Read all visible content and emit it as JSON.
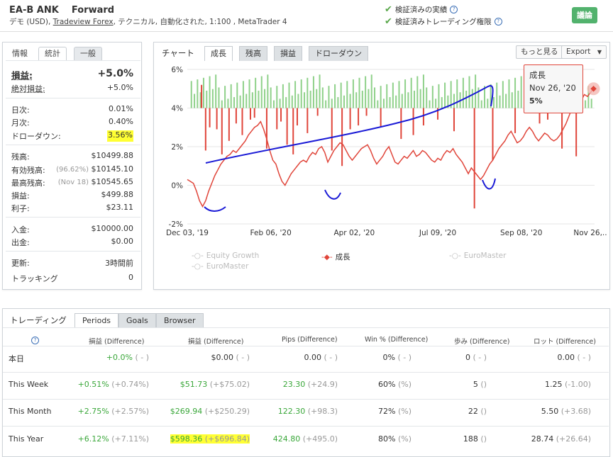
{
  "header": {
    "title": "EA-B ANK    Forward",
    "subtitle_prefix": "デモ (USD), ",
    "broker": "Tradeview Forex",
    "subtitle_suffix": ", テクニカル, 自動化された, 1:100 , MetaTrader 4",
    "verified_track": "検証済みの実績",
    "verified_trading": "検証済みトレーディング権限",
    "discuss_label": "議論"
  },
  "stats": {
    "tabs": [
      "情報",
      "統計",
      "一般"
    ],
    "gain_label": "損益:",
    "gain": "+5.0%",
    "abs_gain_label": "絶対損益:",
    "abs_gain": "+5.0%",
    "daily_label": "日次:",
    "daily": "0.01%",
    "monthly_label": "月次:",
    "monthly": "0.40%",
    "drawdown_label": "ドローダウン:",
    "drawdown": "3.56%",
    "balance_label": "残高:",
    "balance": "$10499.88",
    "equity_label": "有効残高:",
    "equity_pct": "(96.62%)",
    "equity": "$10145.10",
    "highest_label": "最高残高:",
    "highest_date": "(Nov 18)",
    "highest": "$10545.65",
    "profit_label": "損益:",
    "profit": "$499.88",
    "interest_label": "利子:",
    "interest": "$23.11",
    "deposits_label": "入金:",
    "deposits": "$10000.00",
    "withdrawals_label": "出金:",
    "withdrawals": "$0.00",
    "updated_label": "更新:",
    "updated": "3時間前",
    "tracking_label": "トラッキング",
    "tracking": "0"
  },
  "chart_panel": {
    "title": "チャート",
    "tabs": [
      "成長",
      "残高",
      "損益",
      "ドローダウン"
    ],
    "more_button": "もっと見る",
    "export_button": "Export",
    "tooltip": {
      "series": "成長",
      "date": "Nov 26, '20",
      "value": "5%"
    },
    "legend": [
      "Equity Growth",
      "成長",
      "EuroMaster",
      "EuroMaster"
    ]
  },
  "chart_data": {
    "type": "line",
    "y_ticks": [
      "6%",
      "4%",
      "2%",
      "0%",
      "-2%"
    ],
    "ylim": [
      -2,
      6
    ],
    "x_ticks": [
      "Dec 03, '19",
      "Feb 06, '20",
      "Apr 02, '20",
      "Jul 09, '20",
      "Sep 08, '20",
      "Nov 26,..."
    ],
    "series": [
      {
        "name": "成長",
        "color": "#e0453a",
        "x": [
          0,
          3,
          6,
          9,
          12,
          15,
          18,
          21,
          24,
          27,
          30,
          33,
          36,
          39,
          42,
          45,
          48,
          51,
          54,
          57,
          60,
          63,
          66,
          69,
          72,
          75,
          78,
          81,
          84,
          87,
          90,
          93,
          96,
          99,
          102,
          105,
          108,
          111,
          114,
          117,
          120,
          123,
          126,
          129,
          132,
          135,
          138,
          141,
          144,
          147,
          150,
          153,
          156,
          159,
          162,
          165,
          168,
          171,
          174,
          177,
          180,
          183,
          186,
          189,
          192,
          195,
          198,
          201,
          204,
          207,
          210,
          213,
          216,
          219,
          222,
          225,
          228,
          231,
          234,
          237,
          240,
          243,
          246,
          249,
          252,
          255,
          258,
          261,
          264,
          267,
          270,
          273,
          276,
          279,
          282,
          285,
          288,
          291,
          294,
          297,
          300,
          303,
          306,
          309,
          312,
          315,
          318,
          321,
          324,
          327,
          330,
          333,
          336,
          339,
          342,
          345,
          348,
          351,
          354,
          357,
          360,
          363,
          366,
          369,
          372,
          375,
          378,
          381,
          384,
          387,
          390,
          393,
          396,
          399
        ],
        "values": [
          0.3,
          0.2,
          0.1,
          -0.3,
          -0.8,
          -1.1,
          -0.8,
          -0.3,
          0.1,
          0.5,
          0.8,
          1.1,
          1.3,
          1.5,
          1.6,
          1.8,
          1.7,
          1.9,
          2.1,
          2.3,
          2.6,
          2.8,
          3.0,
          3.1,
          3.3,
          2.9,
          2.4,
          1.8,
          1.3,
          1.1,
          0.6,
          0.2,
          0.0,
          0.3,
          0.6,
          0.8,
          1.0,
          1.2,
          1.3,
          1.2,
          1.5,
          1.7,
          1.6,
          1.9,
          2.0,
          1.7,
          1.2,
          1.5,
          1.8,
          2.0,
          2.2,
          2.1,
          1.8,
          1.5,
          1.3,
          1.5,
          1.7,
          1.9,
          2.0,
          2.1,
          1.8,
          1.4,
          1.1,
          1.3,
          1.5,
          1.8,
          2.0,
          1.6,
          1.2,
          1.1,
          1.3,
          1.5,
          1.4,
          1.6,
          1.8,
          1.5,
          1.6,
          1.8,
          1.7,
          1.5,
          1.3,
          1.2,
          1.4,
          1.3,
          1.6,
          1.8,
          1.7,
          1.9,
          1.6,
          1.4,
          1.2,
          0.9,
          0.6,
          0.9,
          0.7,
          0.5,
          0.3,
          0.5,
          0.8,
          1.1,
          1.3,
          1.6,
          1.9,
          2.1,
          2.3,
          2.6,
          2.8,
          2.5,
          2.2,
          2.3,
          2.5,
          2.8,
          3.0,
          2.8,
          2.5,
          2.3,
          2.5,
          2.7,
          2.6,
          2.4,
          2.3,
          2.4,
          2.6,
          2.9,
          3.2,
          3.6,
          4.0,
          4.4,
          4.1,
          4.4,
          4.7,
          4.6,
          4.8,
          5.0
        ]
      }
    ],
    "bars_description_values": {
      "x": [
        14,
        18,
        22,
        29,
        34,
        41,
        48,
        54,
        62,
        66,
        78,
        88,
        92,
        98,
        104,
        108,
        118,
        128,
        142,
        152,
        160,
        168,
        176,
        190,
        210,
        222,
        232,
        246,
        262,
        282,
        300,
        322,
        346,
        354,
        368,
        382
      ],
      "values": [
        1.2,
        -2.2,
        -1.0,
        -1.1,
        -2.4,
        -1.7,
        -0.8,
        -1.4,
        -0.6,
        -0.5,
        -2.1,
        -1.1,
        -0.7,
        -1.9,
        -2.4,
        -0.9,
        -1.3,
        -0.4,
        -2.2,
        -3.0,
        -1.1,
        -0.9,
        -0.4,
        -1.0,
        -1.6,
        -1.4,
        -0.9,
        -0.6,
        -1.2,
        -5.2,
        -2.7,
        -1.3,
        -0.8,
        -0.6,
        -2.1,
        -2.5
      ]
    }
  },
  "trading": {
    "title": "トレーディング",
    "tabs": [
      "Periods",
      "Goals",
      "Browser"
    ],
    "headers": [
      "損益 (Difference)",
      "損益 (Difference)",
      "Pips (Difference)",
      "Win % (Difference)",
      "歩み (Difference)",
      "ロット (Difference)"
    ],
    "rows": [
      {
        "period": "本日",
        "gain": "+0.0%",
        "gain_diff": "( - )",
        "profit": "$0.00",
        "profit_diff": "( - )",
        "pips": "0.00",
        "pips_diff": "( - )",
        "win": "0%",
        "win_diff": "( - )",
        "trades": "0",
        "trades_diff": "( - )",
        "lots": "0.00",
        "lots_diff": "( - )"
      },
      {
        "period": "This Week",
        "gain": "+0.51%",
        "gain_diff": "(+0.74%)",
        "profit": "$51.73",
        "profit_diff": "(+$75.02)",
        "pips": "23.30",
        "pips_diff": "(+24.9)",
        "win": "60%",
        "win_diff": "(%)",
        "trades": "5",
        "trades_diff": "()",
        "lots": "1.25",
        "lots_diff": "(-1.00)"
      },
      {
        "period": "This Month",
        "gain": "+2.75%",
        "gain_diff": "(+2.57%)",
        "profit": "$269.94",
        "profit_diff": "(+$250.29)",
        "pips": "122.30",
        "pips_diff": "(+98.3)",
        "win": "72%",
        "win_diff": "(%)",
        "trades": "22",
        "trades_diff": "()",
        "lots": "5.50",
        "lots_diff": "(+3.68)"
      },
      {
        "period": "This Year",
        "gain": "+6.12%",
        "gain_diff": "(+7.11%)",
        "profit": "$598.36",
        "profit_diff": "(+$696.84)",
        "pips": "424.80",
        "pips_diff": "(+495.0)",
        "win": "80%",
        "win_diff": "(%)",
        "trades": "188",
        "trades_diff": "()",
        "lots": "28.74",
        "lots_diff": "(+26.64)"
      }
    ]
  }
}
